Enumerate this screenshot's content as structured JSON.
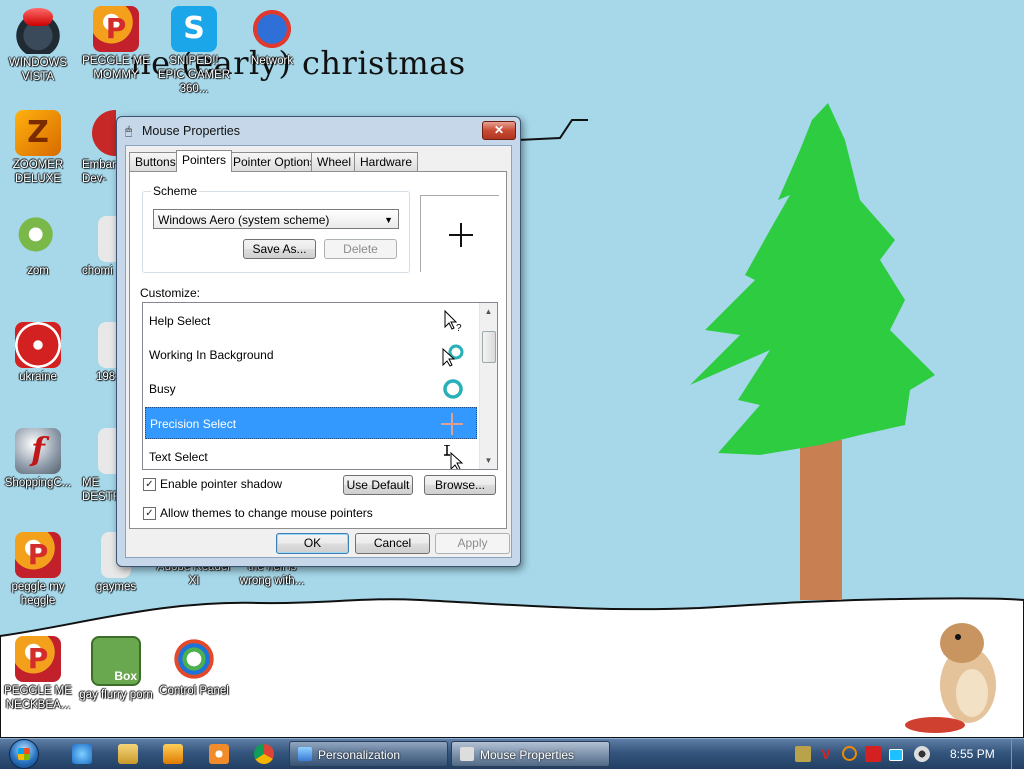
{
  "desktop": {
    "wallpaper_text": "merry (early) christmas",
    "wallpaper_text_visible": "ne   (early) christmas",
    "icons": [
      {
        "label": "WINDOWS VISTA",
        "icon": "vista-game-icon"
      },
      {
        "label": "PEGGLE ME MOMMY",
        "icon": "peggle-icon"
      },
      {
        "label": "SNIPED!! EPIC GAMER 360...",
        "icon": "skype-icon"
      },
      {
        "label": "Network",
        "icon": "network-icon"
      },
      {
        "label": "ZOOMER DELUXE",
        "icon": "zoomer-icon"
      },
      {
        "label": "Embar Dev-",
        "icon": "embarcadero-icon"
      },
      {
        "label": "zom",
        "icon": "zom-icon"
      },
      {
        "label": "chomi",
        "icon": "chomi-icon"
      },
      {
        "label": "ukraine",
        "icon": "radiation-icon"
      },
      {
        "label": "198",
        "icon": "document-icon"
      },
      {
        "label": "ShoppingC...",
        "icon": "flash-icon"
      },
      {
        "label": "ME DESTR",
        "icon": "me-destr-icon"
      },
      {
        "label": "peggle my heggle",
        "icon": "peggle-icon"
      },
      {
        "label": "gaymes",
        "icon": "folder-icon"
      },
      {
        "label": "Adobe Reader XI",
        "icon": "adobe-reader-icon"
      },
      {
        "label": "the hell is wrong with...",
        "icon": "shortcut-icon"
      },
      {
        "label": "PEGGLE ME NECKBEA...",
        "icon": "peggle-icon"
      },
      {
        "label": "gay flurry porn",
        "icon": "box-icon"
      },
      {
        "label": "Control Panel",
        "icon": "control-panel-icon"
      }
    ]
  },
  "dialog": {
    "title": "Mouse Properties",
    "close_glyph": "✕",
    "tabs": [
      "Buttons",
      "Pointers",
      "Pointer Options",
      "Wheel",
      "Hardware"
    ],
    "active_tab": "Pointers",
    "scheme": {
      "group_label": "Scheme",
      "selected": "Windows Aero (system scheme)",
      "save_as_label": "Save As...",
      "delete_label": "Delete"
    },
    "customize_label": "Customize:",
    "pointers": [
      {
        "name": "Help Select",
        "icon": "help-select-cursor-icon"
      },
      {
        "name": "Working In Background",
        "icon": "working-background-cursor-icon"
      },
      {
        "name": "Busy",
        "icon": "busy-cursor-icon"
      },
      {
        "name": "Precision Select",
        "icon": "precision-select-cursor-icon",
        "selected": true
      },
      {
        "name": "Text Select",
        "icon": "text-select-cursor-icon"
      }
    ],
    "enable_shadow": {
      "label": "Enable pointer shadow",
      "checked": true
    },
    "use_default_label": "Use Default",
    "browse_label": "Browse...",
    "allow_themes": {
      "label": "Allow themes to change mouse pointers",
      "checked": true
    },
    "ok_label": "OK",
    "cancel_label": "Cancel",
    "apply_label": "Apply"
  },
  "taskbar": {
    "buttons": [
      {
        "label": "Personalization",
        "icon": "personalization-icon"
      },
      {
        "label": "Mouse Properties",
        "icon": "mouse-icon",
        "active": true
      }
    ],
    "clock": "8:55 PM"
  },
  "colors": {
    "sky": "#a6d8ea",
    "tree_green": "#2ecc40",
    "trunk": "#c87f52",
    "selection": "#3399ff"
  }
}
